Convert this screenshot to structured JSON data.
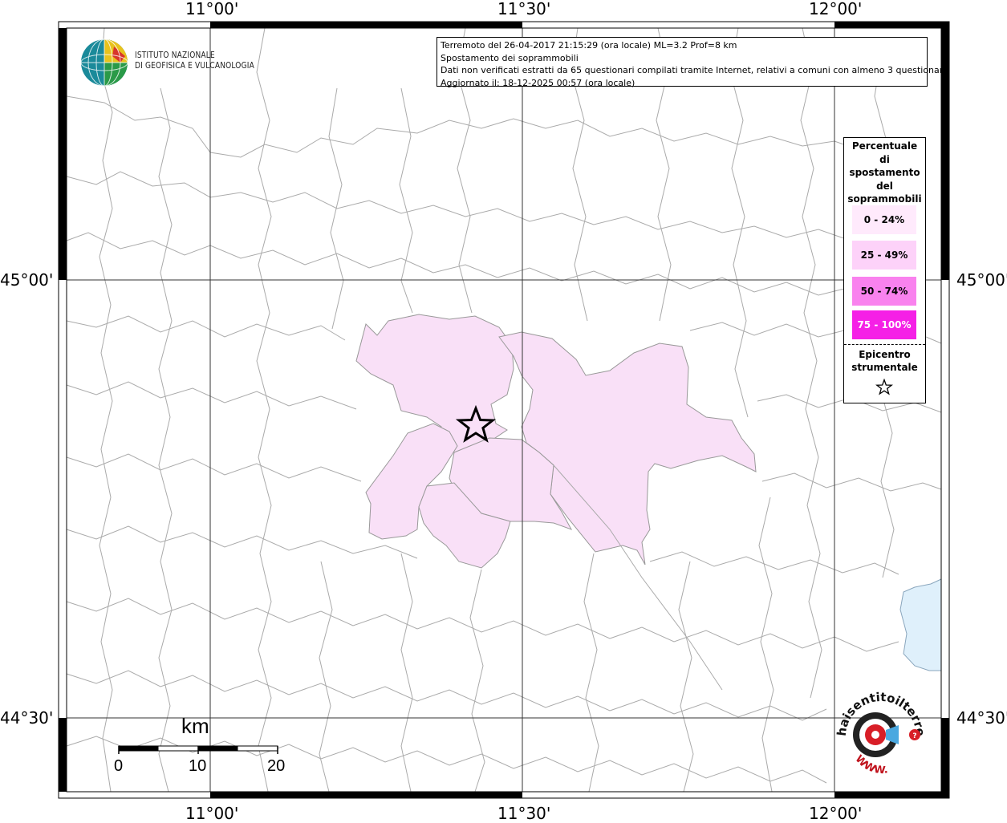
{
  "info": {
    "line1": "Terremoto del 26-04-2017 21:15:29 (ora locale) ML=3.2 Prof=8 km",
    "line2": "Spostamento dei soprammobili",
    "line3": "Dati non verificati estratti da 65 questionari compilati tramite Internet, relativi a comuni con almeno 3 questionari.",
    "line4": "Aggiornato il: 18-12-2025 00:57 (ora locale)"
  },
  "ingv": {
    "line1": "ISTITUTO NAZIONALE",
    "line2": "DI GEOFISICA E VULCANOLOGIA"
  },
  "axes": {
    "top": [
      "11°00'",
      "11°30'",
      "12°00'"
    ],
    "bottom": [
      "11°00'",
      "11°30'",
      "12°00'"
    ],
    "left": [
      "45°00'",
      "44°30'"
    ],
    "right": [
      "45°00'",
      "44°30'"
    ]
  },
  "legend": {
    "title": [
      "Percentuale",
      "di",
      "spostamento",
      "del",
      "soprammobili"
    ],
    "items": [
      {
        "label": "0 - 24%",
        "color": "#ffeafc"
      },
      {
        "label": "25 - 49%",
        "color": "#fdd2f9"
      },
      {
        "label": "50 - 74%",
        "color": "#f982ee"
      },
      {
        "label": "75 - 100%",
        "color": "#f520e6"
      }
    ],
    "epicentre": [
      "Epicentro",
      "strumentale"
    ]
  },
  "scale": {
    "unit": "km",
    "ticks": [
      "0",
      "10",
      "20"
    ]
  },
  "hst": {
    "brand": "haisentitoilterremoto.it",
    "www": "WWW."
  },
  "colors": {
    "felt_area": "#f9e0f7",
    "sea": "#dff0fb",
    "border_lines": "#aaaaaa"
  }
}
